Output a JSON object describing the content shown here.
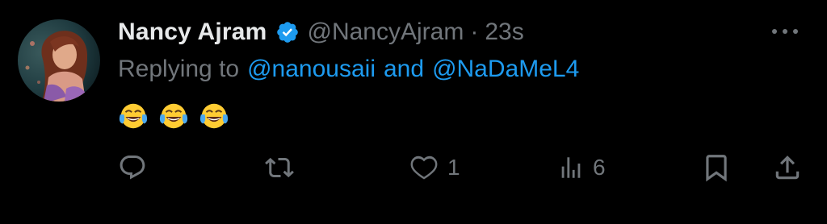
{
  "tweet": {
    "author_name": "Nancy Ajram",
    "handle": "@NancyAjram",
    "separator": "·",
    "time": "23s",
    "verified": true,
    "replying_prefix": "Replying to",
    "reply_mention_1": "@nanousaii",
    "reply_and": "and",
    "reply_mention_2": "@NaDaMeL4",
    "content_emojis": [
      "face-with-tears-of-joy",
      "face-with-tears-of-joy",
      "face-with-tears-of-joy"
    ]
  },
  "actions": {
    "reply_count": "",
    "retweet_count": "",
    "like_count": "1",
    "views_count": "6"
  },
  "icons": {
    "verified": "verified-badge-icon",
    "more": "more-options-icon",
    "reply": "reply-icon",
    "retweet": "retweet-icon",
    "like": "heart-icon",
    "views": "views-icon",
    "bookmark": "bookmark-icon",
    "share": "share-icon"
  },
  "colors": {
    "background": "#000000",
    "primary_text": "#e7e9ea",
    "secondary_text": "#71767b",
    "accent": "#1d9bf0"
  }
}
